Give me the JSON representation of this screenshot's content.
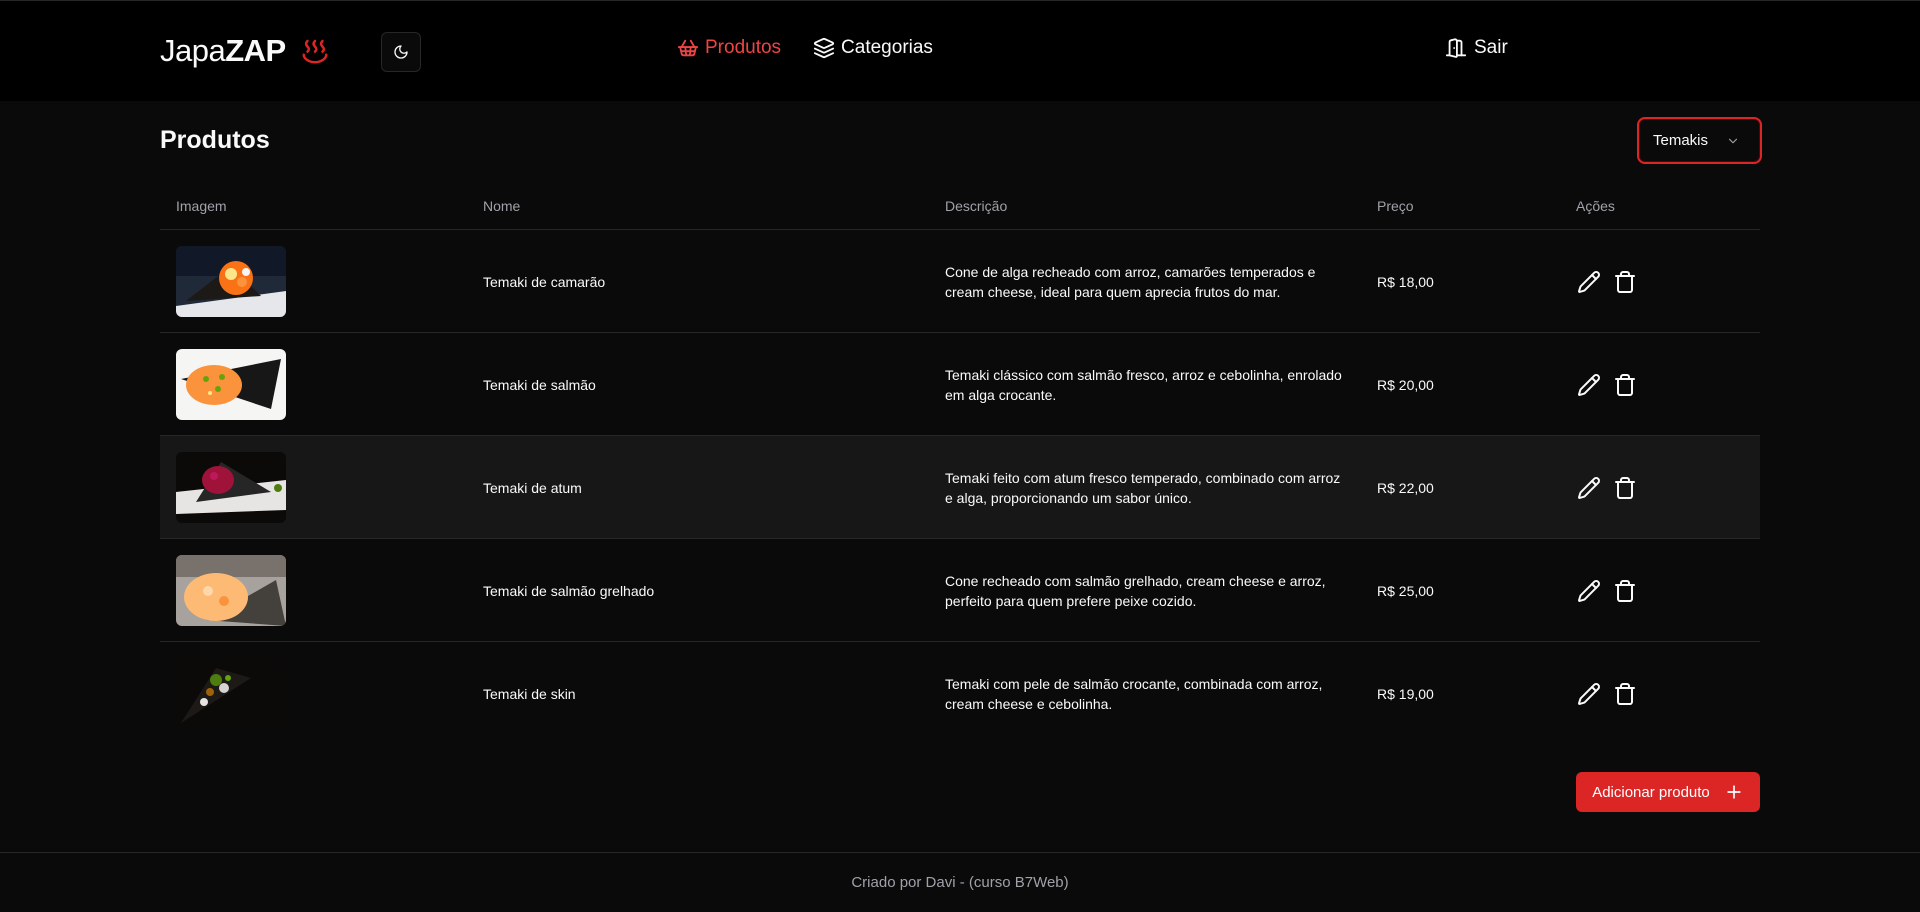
{
  "brand": {
    "light": "Japa",
    "bold": "ZAP",
    "icon": "flame-icon"
  },
  "theme_toggle": {
    "icon": "moon-icon"
  },
  "nav": [
    {
      "label": "Produtos",
      "icon": "basket-icon",
      "active": true
    },
    {
      "label": "Categorias",
      "icon": "layers-icon",
      "active": false
    }
  ],
  "logout": {
    "label": "Sair",
    "icon": "door-icon"
  },
  "page": {
    "title": "Produtos"
  },
  "category_select": {
    "value": "Temakis"
  },
  "table": {
    "headers": [
      "Imagem",
      "Nome",
      "Descrição",
      "Preço",
      "Ações"
    ],
    "rows": [
      {
        "name": "Temaki de camarão",
        "description": "Cone de alga recheado com arroz, camarões temperados e cream cheese, ideal para quem aprecia frutos do mar.",
        "price": "R$ 18,00"
      },
      {
        "name": "Temaki de salmão",
        "description": "Temaki clássico com salmão fresco, arroz e cebolinha, enrolado em alga crocante.",
        "price": "R$ 20,00"
      },
      {
        "name": "Temaki de atum",
        "description": "Temaki feito com atum fresco temperado, combinado com arroz e alga, proporcionando um sabor único.",
        "price": "R$ 22,00"
      },
      {
        "name": "Temaki de salmão grelhado",
        "description": "Cone recheado com salmão grelhado, cream cheese e arroz, perfeito para quem prefere peixe cozido.",
        "price": "R$ 25,00"
      },
      {
        "name": "Temaki de skin",
        "description": "Temaki com pele de salmão crocante, combinada com arroz, cream cheese e cebolinha.",
        "price": "R$ 19,00"
      }
    ]
  },
  "add_button": {
    "label": "Adicionar produto",
    "icon": "plus-icon"
  },
  "footer": {
    "text": "Criado por Davi - (curso B7Web)"
  },
  "colors": {
    "accent": "#dc2626",
    "background": "#0a0a0a",
    "header": "#000000",
    "muted": "#a1a1aa"
  }
}
